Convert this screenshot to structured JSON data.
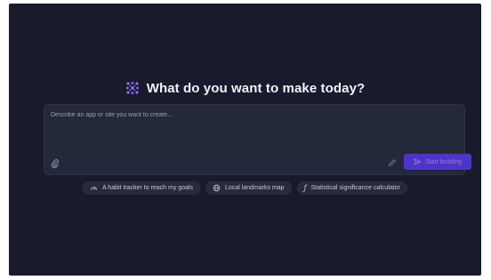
{
  "headline": {
    "logo": "grid-spark-logo",
    "text": "What do you want to make today?"
  },
  "composer": {
    "placeholder": "Describe an app or site you want to create...",
    "value": "",
    "attach_icon": "paperclip-icon",
    "enhance_icon": "pencil-icon",
    "start_button": {
      "label": "Start building",
      "icon": "send-arrow-icon"
    }
  },
  "suggestions": [
    {
      "icon": "gauge-icon",
      "label": "A habit tracker to reach my goals"
    },
    {
      "icon": "globe-icon",
      "label": "Local landmarks map"
    },
    {
      "icon": "function-icon",
      "label": "Statistical significance calculator"
    }
  ],
  "colors": {
    "background": "#171b2b",
    "composer": "#23283a",
    "accent": "#4f35c7",
    "logo": "#8b6cf0"
  }
}
